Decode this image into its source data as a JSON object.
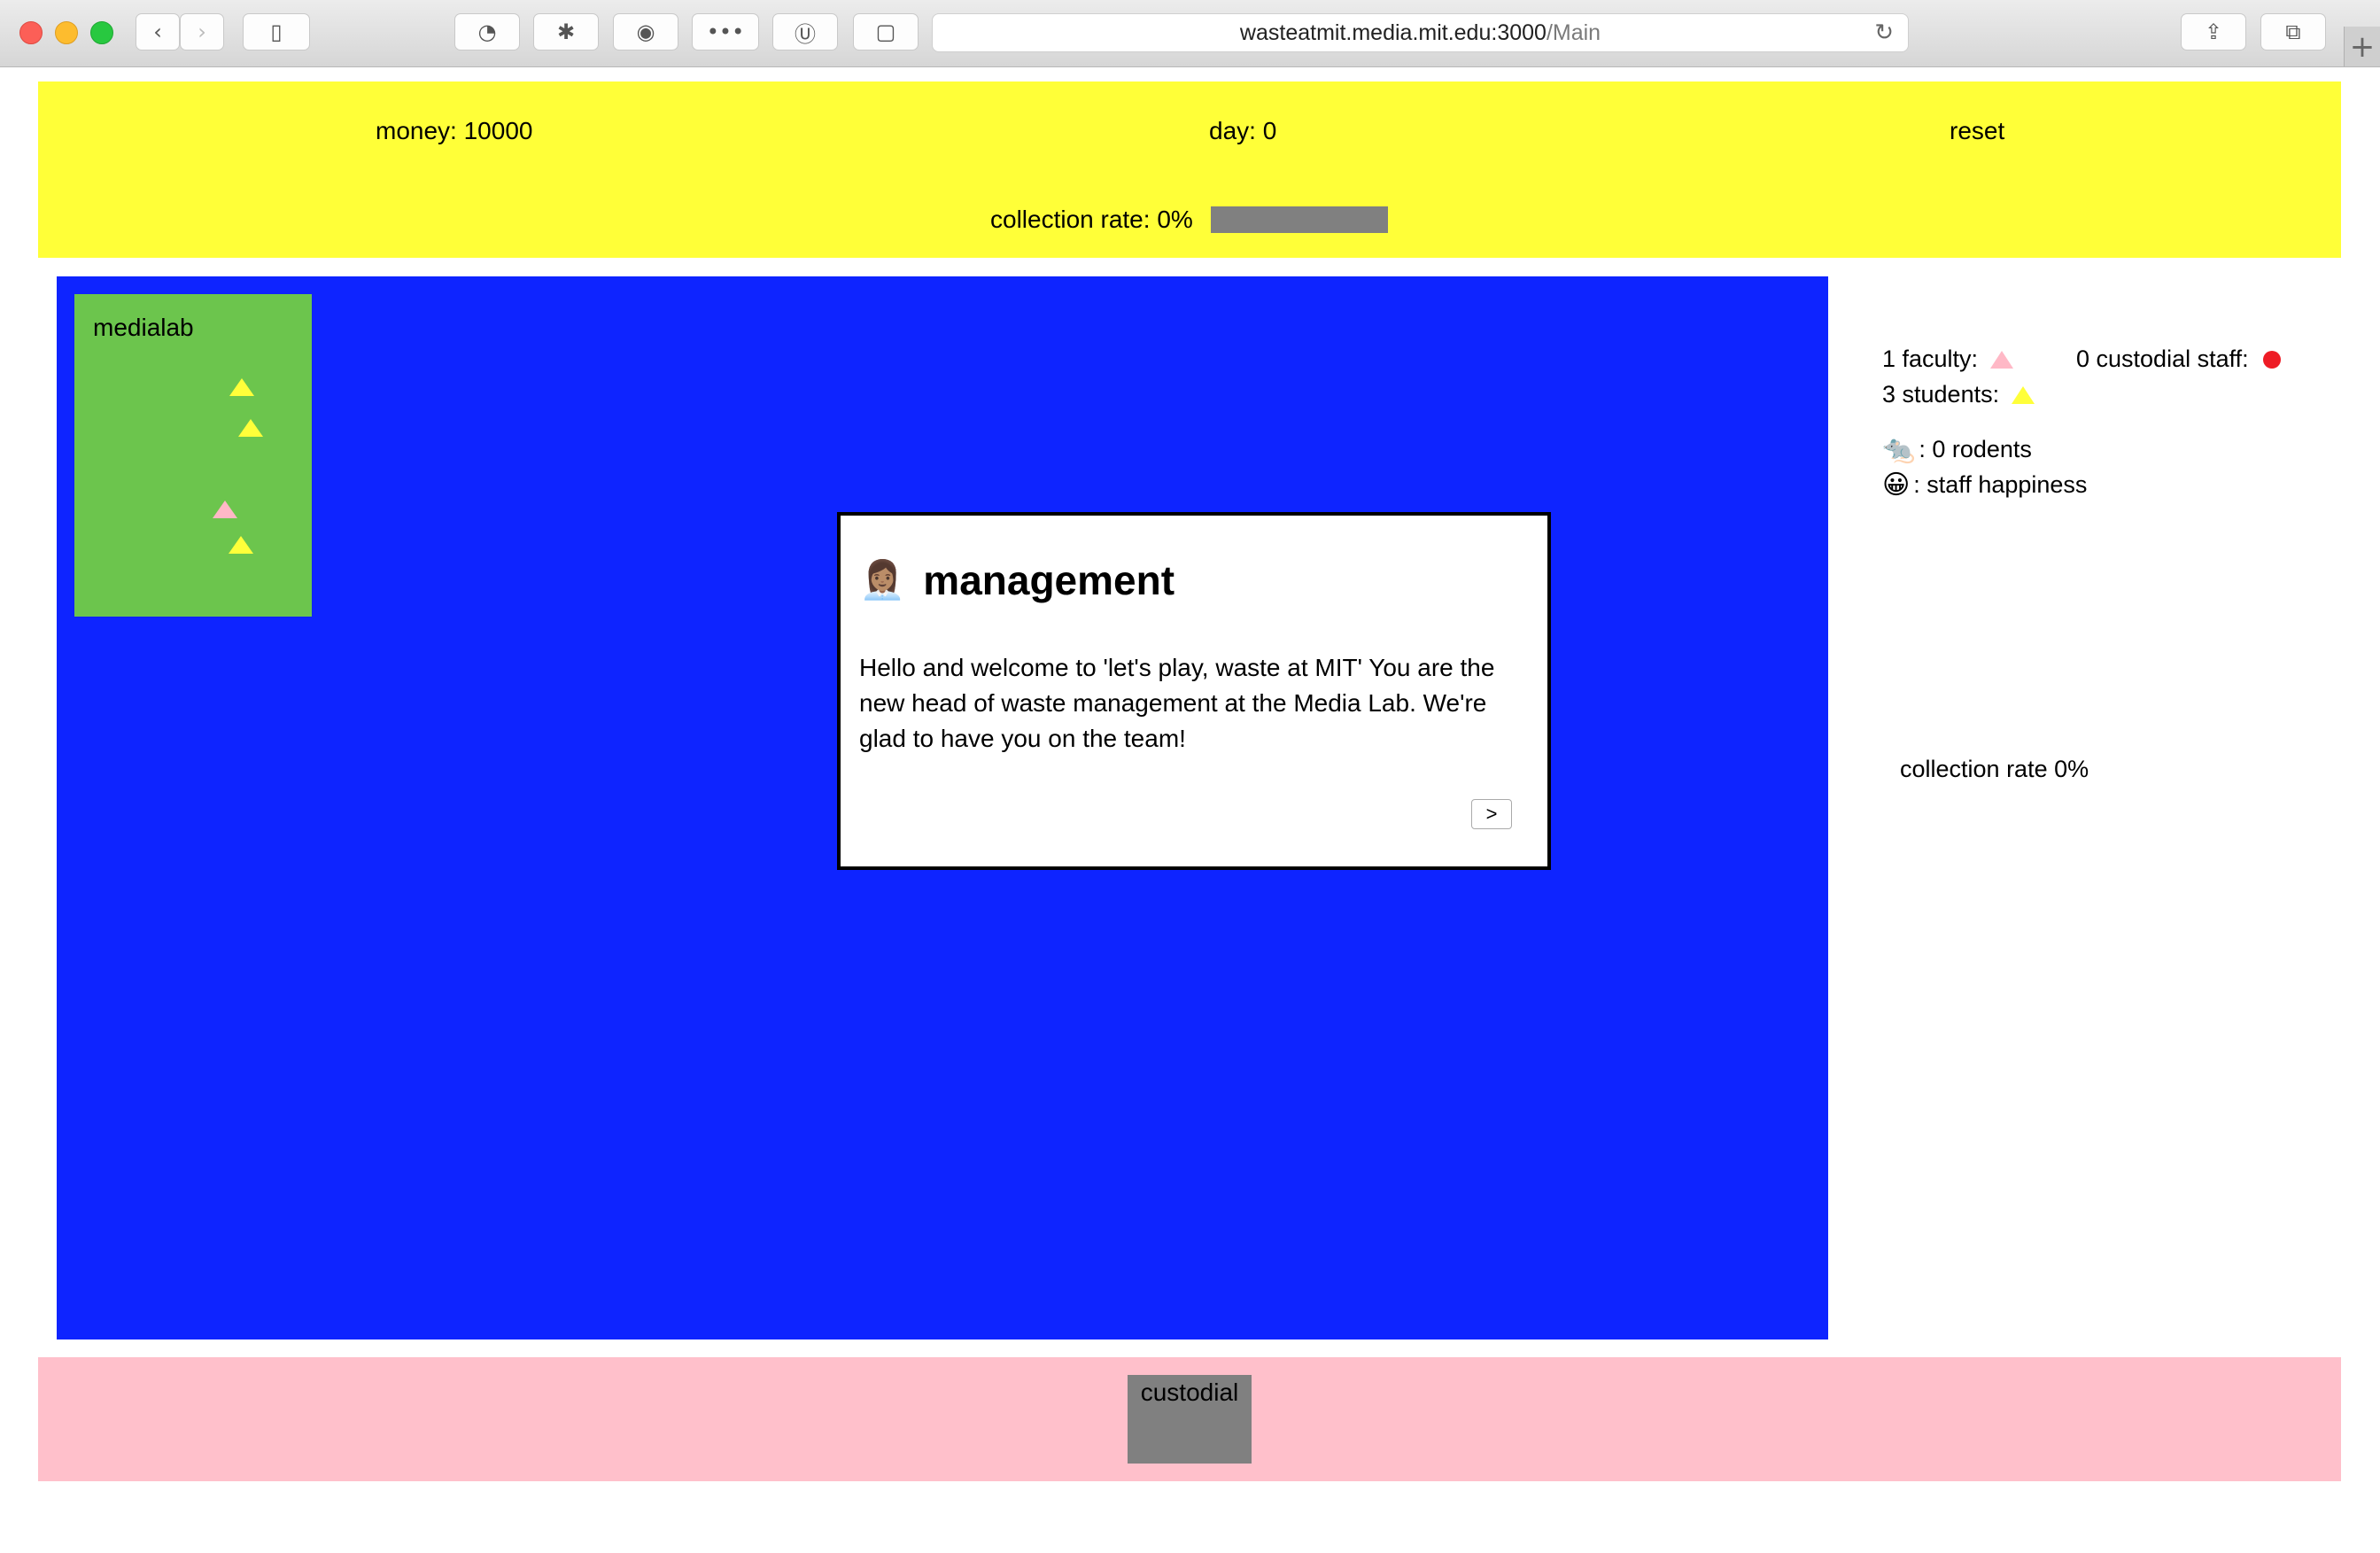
{
  "browser": {
    "url_host": "wasteatmit.media.mit.edu:3000",
    "url_path": "/Main"
  },
  "header": {
    "money_label": "money: 10000",
    "day_label": "day: 0",
    "reset_label": "reset",
    "collection_rate_label": "collection rate: 0%",
    "collection_rate_value": 0
  },
  "map": {
    "building": {
      "label": "medialab",
      "occupants": [
        {
          "kind": "student",
          "color": "#ffff3a"
        },
        {
          "kind": "student",
          "color": "#ffff3a"
        },
        {
          "kind": "faculty",
          "color": "#ffb8c6"
        },
        {
          "kind": "student",
          "color": "#ffff3a"
        }
      ]
    }
  },
  "dialog": {
    "emoji": "👩🏽‍💼",
    "title": "management",
    "text": "Hello and welcome to 'let's play, waste at MIT' You are the new head of waste management at the Media Lab. We're glad to have you on the team!",
    "next_label": ">"
  },
  "sidebar": {
    "faculty_label": "1 faculty:",
    "faculty_color": "#ffb8c6",
    "custodial_label": "0 custodial staff:",
    "custodial_color": "#ee1c25",
    "students_label": "3 students:",
    "students_color": "#ffff3a",
    "rodents_emoji": "🐀",
    "rodents_label": ": 0 rodents",
    "happiness_emoji": "😀",
    "happiness_label": ": staff happiness",
    "collection_rate_label": "collection rate 0%"
  },
  "bottom": {
    "custodial_label": "custodial"
  },
  "colors": {
    "header_bg": "#ffff38",
    "map_bg": "#0e24ff",
    "building_bg": "#6cc54d",
    "bottom_bg": "#ffc0cb"
  }
}
